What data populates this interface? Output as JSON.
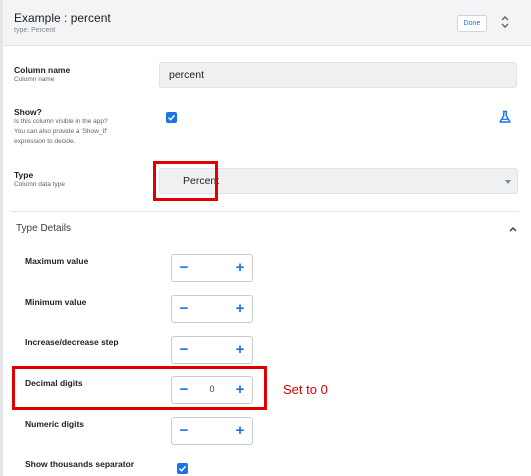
{
  "header": {
    "title": "Example : percent",
    "subtitle": "type: Percent",
    "done_label": "Done"
  },
  "column_name": {
    "label": "Column name",
    "sublabel": "Column name",
    "value": "percent"
  },
  "show": {
    "label": "Show?",
    "sublabel_lines": [
      "Is this column visible in the app?",
      "You can also provide a 'Show_If'",
      "expression to decide."
    ],
    "checked": true
  },
  "type": {
    "label": "Type",
    "sublabel": "Column data type",
    "value": "Percent"
  },
  "type_details": {
    "title": "Type Details",
    "fields": [
      {
        "label": "Maximum value",
        "value": ""
      },
      {
        "label": "Minimum value",
        "value": ""
      },
      {
        "label": "Increase/decrease step",
        "value": ""
      },
      {
        "label": "Decimal digits",
        "value": "0"
      },
      {
        "label": "Numeric digits",
        "value": ""
      }
    ],
    "thousands_separator": {
      "label": "Show thousands separator",
      "checked": true
    }
  },
  "annotation": {
    "text": "Set to 0",
    "color": "#d40000"
  },
  "colors": {
    "accent": "#1a73e8",
    "highlight": "#e00000"
  }
}
